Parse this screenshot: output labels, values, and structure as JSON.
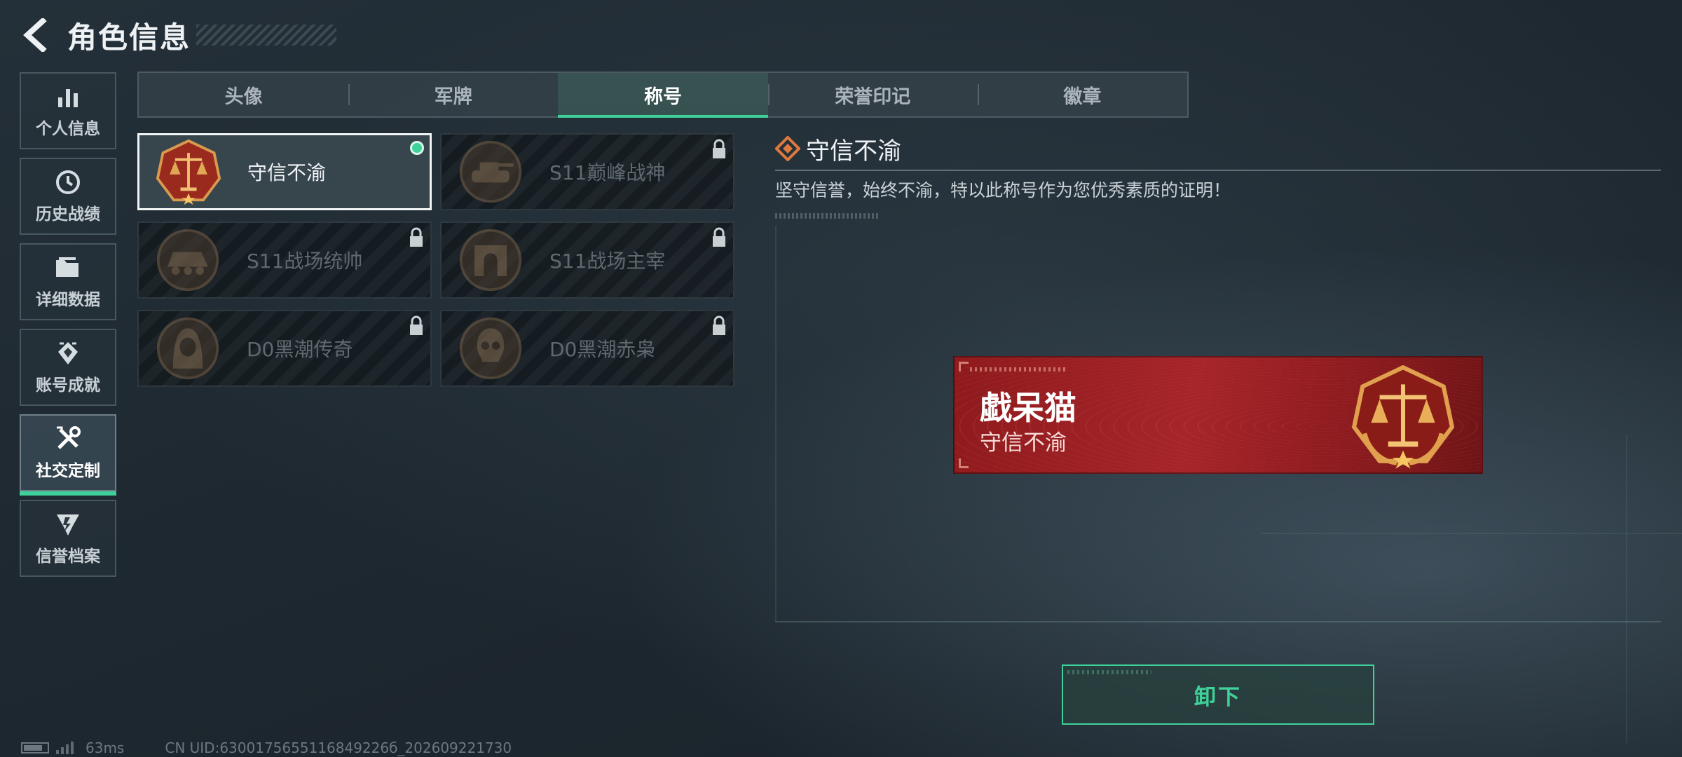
{
  "header": {
    "title": "角色信息"
  },
  "sidebar": {
    "items": [
      {
        "label": "个人信息",
        "icon": "bar-chart-icon"
      },
      {
        "label": "历史战绩",
        "icon": "clock-icon"
      },
      {
        "label": "详细数据",
        "icon": "folder-icon"
      },
      {
        "label": "账号成就",
        "icon": "achievement-icon"
      },
      {
        "label": "社交定制",
        "icon": "tools-icon",
        "active": true
      },
      {
        "label": "信誉档案",
        "icon": "credit-emblem-icon"
      }
    ]
  },
  "tabs": [
    {
      "label": "头像"
    },
    {
      "label": "军牌"
    },
    {
      "label": "称号",
      "active": true
    },
    {
      "label": "荣誉印记"
    },
    {
      "label": "徽章"
    }
  ],
  "titles": [
    {
      "name": "守信不渝",
      "selected": true,
      "equipped": true,
      "locked": false,
      "badge": "scales-badge-icon"
    },
    {
      "name": "S11巅峰战神",
      "selected": false,
      "locked": true,
      "badge": "tank-badge-icon"
    },
    {
      "name": "S11战场统帅",
      "selected": false,
      "locked": true,
      "badge": "apc-badge-icon"
    },
    {
      "name": "S11战场主宰",
      "selected": false,
      "locked": true,
      "badge": "arch-badge-icon"
    },
    {
      "name": "D0黑潮传奇",
      "selected": false,
      "locked": true,
      "badge": "hooded-soldier-badge-icon"
    },
    {
      "name": "D0黑潮赤枭",
      "selected": false,
      "locked": true,
      "badge": "skull-badge-icon"
    }
  ],
  "detail": {
    "title": "守信不渝",
    "description": "坚守信誉，始终不渝，特以此称号作为您优秀素质的证明！"
  },
  "nameplate": {
    "player_name": "戱呆猫",
    "title": "守信不渝",
    "background_color": "#a6252a"
  },
  "actions": {
    "unequip_label": "卸下"
  },
  "status": {
    "ping": "63ms",
    "uid": "CN UID:6300175655116849226б_202609221730",
    "battery_level": 0.8
  },
  "colors": {
    "accent": "#3fd19a",
    "title_card_selected_border": "#f2f4f5",
    "nameplate_red": "#a6252a"
  }
}
